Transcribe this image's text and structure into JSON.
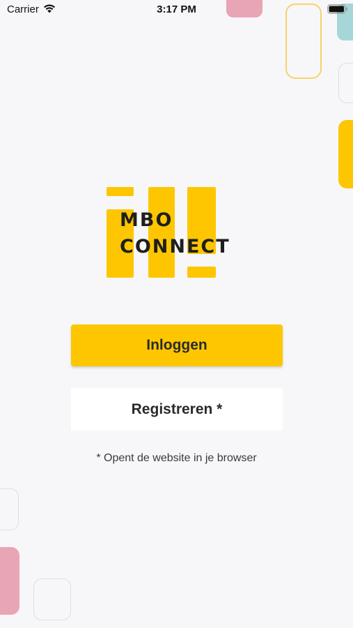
{
  "status_bar": {
    "carrier": "Carrier",
    "time": "3:17 PM",
    "wifi_icon": "wifi-icon",
    "battery_icon": "battery-icon"
  },
  "logo": {
    "line1": "MBO",
    "line2": "CONNECT",
    "color": "#fdc600"
  },
  "actions": {
    "login_label": "Inloggen",
    "register_label": "Registreren *"
  },
  "note": "* Opent de website in je browser",
  "colors": {
    "accent": "#fdc600",
    "pink": "#e8a5b5",
    "teal": "#a7d6d9",
    "background": "#f7f7f9"
  }
}
